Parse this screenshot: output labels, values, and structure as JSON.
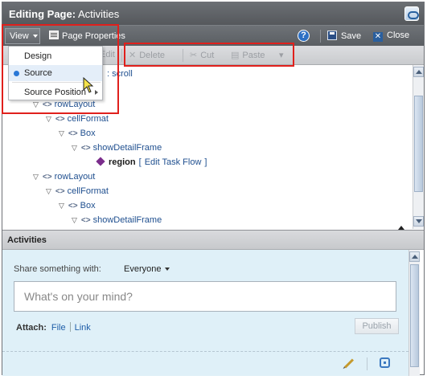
{
  "window": {
    "title_prefix": "Editing Page:",
    "title_page": "Activities"
  },
  "toolbar": {
    "view_label": "View",
    "page_properties_label": "Page Properties",
    "help_label": "?",
    "save_label": "Save",
    "close_label": "Close"
  },
  "editbar": {
    "edit_label": "Edit",
    "delete_label": "Delete",
    "cut_label": "Cut",
    "paste_label": "Paste"
  },
  "view_menu": {
    "items": [
      {
        "label": "Design",
        "selected": false
      },
      {
        "label": "Source",
        "selected": true
      },
      {
        "label": "Source Position",
        "submenu": true
      }
    ]
  },
  "tree": {
    "partial_label": ": scroll",
    "nodes": [
      {
        "label": "rowLayout"
      },
      {
        "label": "cellFormat"
      },
      {
        "label": "Box"
      },
      {
        "label": "showDetailFrame"
      },
      {
        "label": "region",
        "link": "Edit Task Flow",
        "open_bracket": "[",
        "close_bracket": "]"
      },
      {
        "label": "rowLayout"
      },
      {
        "label": "cellFormat"
      },
      {
        "label": "Box"
      },
      {
        "label": "showDetailFrame"
      }
    ]
  },
  "activities": {
    "header": "Activities",
    "share_label": "Share something with:",
    "share_value": "Everyone",
    "status_placeholder": "What's on your mind?",
    "attach_label": "Attach:",
    "attach_file": "File",
    "attach_link": "Link",
    "publish_label": "Publish"
  },
  "colors": {
    "highlight": "#e0201c",
    "link": "#1f4f8f",
    "titlebar": "#5e6166"
  }
}
